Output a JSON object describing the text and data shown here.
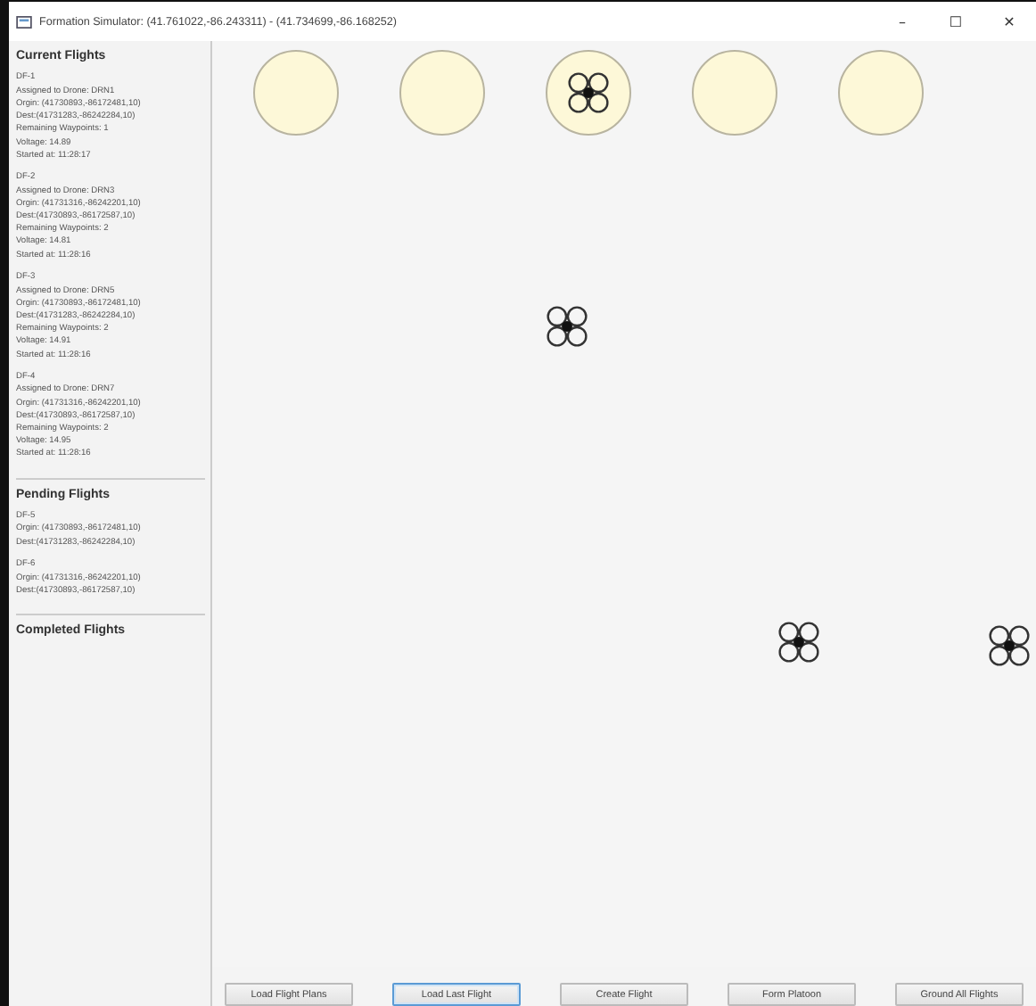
{
  "window": {
    "title": "Formation Simulator: (41.761022,-86.243311) - (41.734699,-86.168252)",
    "controls": [
      "–",
      "☐",
      "✕"
    ]
  },
  "sections": [
    {
      "title": "Current Flights",
      "flights": [
        {
          "id": "DF-1",
          "lines": [
            "Assigned to Drone: DRN1",
            "Orgin: (41730893,-86172481,10)",
            "Dest:(41731283,-86242284,10)",
            "Remaining Waypoints: 1",
            "Voltage: 14.89",
            "Started at: 11:28:17"
          ]
        },
        {
          "id": "DF-2",
          "lines": [
            "Assigned to Drone: DRN3",
            "Orgin: (41731316,-86242201,10)",
            "Dest:(41730893,-86172587,10)",
            "Remaining Waypoints: 2",
            "Voltage: 14.81",
            "Started at: 11:28:16"
          ]
        },
        {
          "id": "DF-3",
          "lines": [
            "Assigned to Drone: DRN5",
            "Orgin: (41730893,-86172481,10)",
            "Dest:(41731283,-86242284,10)",
            "Remaining Waypoints: 2",
            "Voltage: 14.91",
            "Started at: 11:28:16"
          ]
        },
        {
          "id": "DF-4",
          "lines": [
            "Assigned to Drone: DRN7",
            "Orgin: (41731316,-86242201,10)",
            "Dest:(41730893,-86172587,10)",
            "Remaining Waypoints: 2",
            "Voltage: 14.95",
            "Started at: 11:28:16"
          ]
        }
      ]
    },
    {
      "title": "Pending Flights",
      "flights": [
        {
          "id": "DF-5",
          "lines": [
            "Orgin: (41730893,-86172481,10)",
            "Dest:(41731283,-86242284,10)"
          ]
        },
        {
          "id": "DF-6",
          "lines": [
            "Orgin: (41731316,-86242201,10)",
            "Dest:(41730893,-86172587,10)"
          ]
        }
      ]
    },
    {
      "title": "Completed Flights"
    }
  ],
  "landing_pads": [
    {
      "occupied": false
    },
    {
      "occupied": false
    },
    {
      "occupied": true
    },
    {
      "occupied": false
    },
    {
      "occupied": false
    }
  ],
  "buttons": [
    {
      "label": "Load Flight Plans",
      "focused": false
    },
    {
      "label": "Load Last Flight",
      "focused": true
    },
    {
      "label": "Create Flight",
      "focused": false
    },
    {
      "label": "Form Platoon",
      "focused": false
    },
    {
      "label": "Ground All Flights",
      "focused": false
    }
  ]
}
